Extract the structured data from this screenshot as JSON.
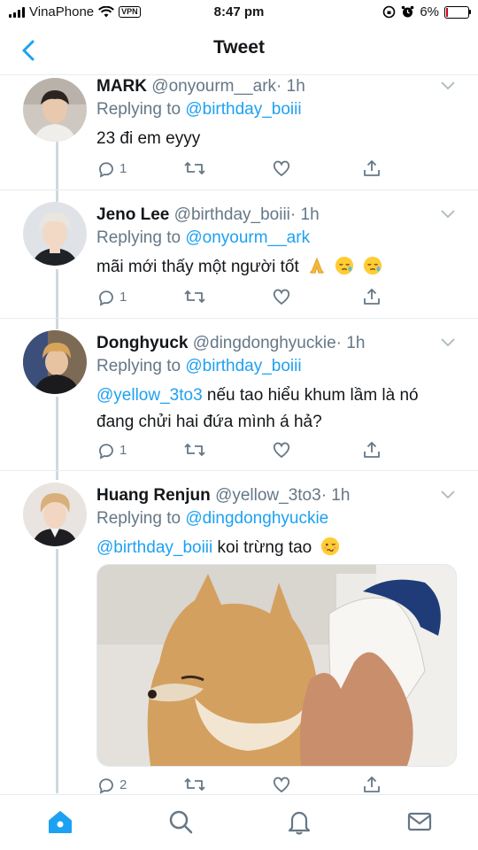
{
  "status_bar": {
    "carrier": "VinaPhone",
    "vpn": "VPN",
    "time": "8:47 pm",
    "battery": "6%",
    "battery_level": 0.06
  },
  "header": {
    "title": "Tweet"
  },
  "tweets": [
    {
      "name": "MARK",
      "handle": "@onyourm__ark",
      "time": "· 1h",
      "replying_prefix": "Replying to",
      "replying_to": "@birthday_boiii",
      "text": "23 đi em eyyy",
      "replies": "1"
    },
    {
      "name": "Jeno Lee",
      "handle": "@birthday_boiii",
      "time": "· 1h",
      "replying_prefix": "Replying to",
      "replying_to": "@onyourm__ark",
      "text": "mãi mới thấy một người tốt",
      "emojis": [
        "folded-hands",
        "sad-face",
        "sad-face"
      ],
      "replies": "1"
    },
    {
      "name": "Donghyuck",
      "handle": "@dingdonghyuckie",
      "time": "· 1h",
      "replying_prefix": "Replying to",
      "replying_to": "@birthday_boiii",
      "mention": "@yellow_3to3",
      "text": " nếu tao hiểu khum lầm là nó",
      "text_line2": "đang chửi hai đứa mình á hả?",
      "replies": "1"
    },
    {
      "name": "Huang Renjun",
      "handle": "@yellow_3to3",
      "time": "· 1h",
      "replying_prefix": "Replying to",
      "replying_to": "@dingdonghyuckie",
      "mention": "@birthday_boiii",
      "text": " koi trừng tao",
      "emojis": [
        "woozy-face"
      ],
      "replies": "2"
    }
  ],
  "colors": {
    "accent": "#1da1f2",
    "muted": "#657786",
    "line": "#cfd9de"
  }
}
